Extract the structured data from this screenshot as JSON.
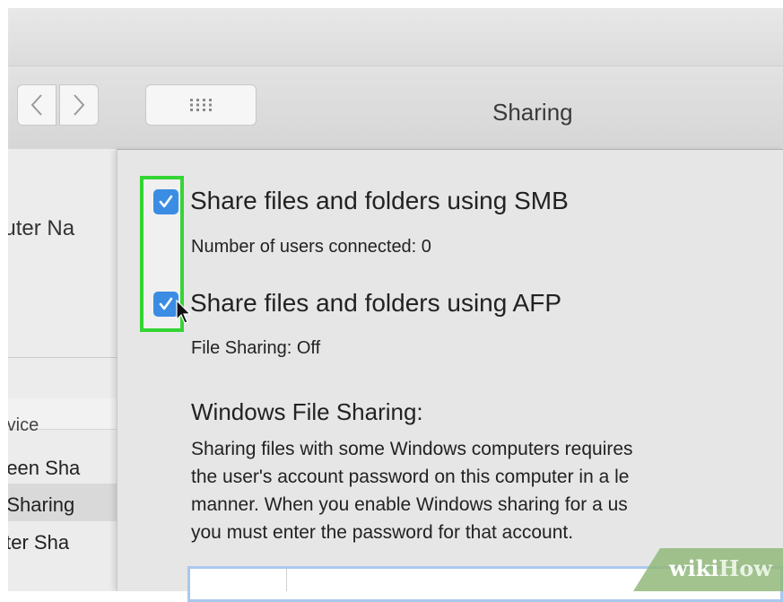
{
  "window": {
    "title": "Sharing",
    "nav_back_icon": "chevron-left-icon",
    "nav_forward_icon": "chevron-right-icon",
    "show_all_icon": "grid-icon"
  },
  "sidebar": {
    "computer_name_label": "puter Na",
    "service_header": "rvice",
    "services": [
      "creen Sha",
      "e Sharing",
      "inter Sha"
    ]
  },
  "panel": {
    "smb_label": "Share files and folders using SMB",
    "smb_checked": true,
    "users_connected": "Number of users connected: 0",
    "afp_label": "Share files and folders using AFP",
    "afp_checked": true,
    "file_sharing_status": "File Sharing: Off",
    "windows_title": "Windows File Sharing:",
    "windows_paragraph": [
      "Sharing files with some Windows computers requires",
      "the user's account password on this computer in a le",
      "manner.  When you enable Windows sharing for a us",
      "you must enter the password for that account."
    ]
  },
  "watermark": {
    "part1": "wiki",
    "part2": "How"
  },
  "colors": {
    "checkbox": "#3b8de3",
    "highlight": "#35d435",
    "panel": "#e6e6e6",
    "toolbar": "#dcdcdc"
  }
}
